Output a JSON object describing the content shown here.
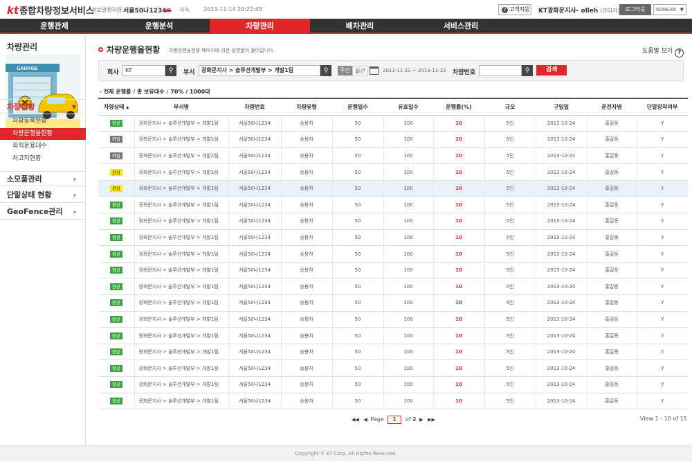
{
  "topbar": {
    "logo_kt": "kt",
    "logo_text": "종합차량정보서비스",
    "alert_label": "경보발생차량 :",
    "alert_plate": "서울50나1234",
    "alert_icon": "🚗",
    "alert_type": "과속",
    "alert_time": "2013-11-14 20:22:45",
    "support_label": "고객지원",
    "user_name": "KT광화문지사- olleh",
    "user_role": "(관리자) 님",
    "logout_label": "로그아웃",
    "lang_label": "KOREAN"
  },
  "nav": [
    "운행관제",
    "운행분석",
    "차량관리",
    "배차관리",
    "서비스관리"
  ],
  "nav_active": "차량관리",
  "sidebar": {
    "title": "차량관리",
    "banner_text": "GARAGE",
    "menus": [
      {
        "label": "차량현황",
        "arrow": "⌄"
      },
      {
        "label": "소모품관리",
        "arrow": "›"
      },
      {
        "label": "단말상태 현황",
        "arrow": "›"
      },
      {
        "label": "GeoFence관리",
        "arrow": "›"
      }
    ],
    "submenus": [
      "차량등록현황",
      "차량운행율현황",
      "최적운용대수",
      "차고지현황"
    ]
  },
  "page": {
    "title": "차량운행율현황",
    "description": "차량운행율현황 페이지에 대한 설명글이 들어갑니다.",
    "help_label": "도움말 보기",
    "help_icon": "?"
  },
  "search": {
    "company_label": "회사",
    "company_value": "KT",
    "dept_label": "부서",
    "dept_value": "광화문지사 > 솔루션개발부 > 개발1팀",
    "period_week": "주간",
    "period_month": "월간",
    "date_range": "2013-11-22 ~ 2013-11-22",
    "plate_label": "차량번호",
    "plate_value": "",
    "search_button": "검색"
  },
  "summary": "· 전체 운행률 / 총 보유대수 : 70% / 1000대",
  "table": {
    "headers": [
      "차량상태 ▴",
      "부서명",
      "차량번호",
      "차량유형",
      "운행일수",
      "유효일수",
      "운행률(%)",
      "규모",
      "구입일",
      "운전자명",
      "단말장착여부"
    ],
    "rows": [
      {
        "status": "정상",
        "dept": "광화문지사 > 솔루션개발부 > 개발1팀",
        "plate": "서울50나1234",
        "type": "승용차",
        "drive_days": "50",
        "valid_days": "100",
        "rate": "10",
        "size": "5인",
        "date": "2013-10-24",
        "driver": "홍길동",
        "device": "Y"
      },
      {
        "status": "꺼짐",
        "dept": "광화문지사 > 솔루션개발부 > 개발1팀",
        "plate": "서울50나1234",
        "type": "승용차",
        "drive_days": "50",
        "valid_days": "100",
        "rate": "10",
        "size": "5인",
        "date": "2013-10-24",
        "driver": "홍길동",
        "device": "Y"
      },
      {
        "status": "꺼짐",
        "dept": "광화문지사 > 솔루션개발부 > 개발1팀",
        "plate": "서울50나1234",
        "type": "승용차",
        "drive_days": "50",
        "valid_days": "100",
        "rate": "10",
        "size": "5인",
        "date": "2013-10-24",
        "driver": "홍길동",
        "device": "Y"
      },
      {
        "status": "관심",
        "dept": "광화문지사 > 솔루션개발부 > 개발1팀",
        "plate": "서울50나1234",
        "type": "승용차",
        "drive_days": "50",
        "valid_days": "100",
        "rate": "10",
        "size": "5인",
        "date": "2013-10-24",
        "driver": "홍길동",
        "device": "Y"
      },
      {
        "status": "관심",
        "dept": "광화문지사 > 솔루션개발부 > 개발1팀",
        "plate": "서울50나1234",
        "type": "승용차",
        "drive_days": "50",
        "valid_days": "100",
        "rate": "10",
        "size": "5인",
        "date": "2013-10-24",
        "driver": "홍길동",
        "device": "Y"
      },
      {
        "status": "정상",
        "dept": "광화문지사 > 솔루션개발부 > 개발1팀",
        "plate": "서울50나1234",
        "type": "승용차",
        "drive_days": "50",
        "valid_days": "100",
        "rate": "10",
        "size": "5인",
        "date": "2013-10-24",
        "driver": "홍길동",
        "device": "Y"
      },
      {
        "status": "정상",
        "dept": "광화문지사 > 솔루션개발부 > 개발1팀",
        "plate": "서울50나1234",
        "type": "승용차",
        "drive_days": "50",
        "valid_days": "100",
        "rate": "10",
        "size": "5인",
        "date": "2013-10-24",
        "driver": "홍길동",
        "device": "Y"
      },
      {
        "status": "정상",
        "dept": "광화문지사 > 솔루션개발부 > 개발1팀",
        "plate": "서울50나1234",
        "type": "승용차",
        "drive_days": "50",
        "valid_days": "100",
        "rate": "10",
        "size": "5인",
        "date": "2013-10-24",
        "driver": "홍길동",
        "device": "Y"
      },
      {
        "status": "정상",
        "dept": "광화문지사 > 솔루션개발부 > 개발1팀",
        "plate": "서울50나1234",
        "type": "승용차",
        "drive_days": "50",
        "valid_days": "100",
        "rate": "10",
        "size": "5인",
        "date": "2013-10-24",
        "driver": "홍길동",
        "device": "Y"
      },
      {
        "status": "정상",
        "dept": "광화문지사 > 솔루션개발부 > 개발1팀",
        "plate": "서울50나1234",
        "type": "승용차",
        "drive_days": "50",
        "valid_days": "100",
        "rate": "10",
        "size": "5인",
        "date": "2013-10-24",
        "driver": "홍길동",
        "device": "Y"
      },
      {
        "status": "정상",
        "dept": "광화문지사 > 솔루션개발부 > 개발1팀",
        "plate": "서울50나1234",
        "type": "승용차",
        "drive_days": "50",
        "valid_days": "100",
        "rate": "10",
        "size": "5인",
        "date": "2013-10-24",
        "driver": "홍길동",
        "device": "Y"
      },
      {
        "status": "정상",
        "dept": "광화문지사 > 솔루션개발부 > 개발1팀",
        "plate": "서울50나1234",
        "type": "승용차",
        "drive_days": "50",
        "valid_days": "100",
        "rate": "10",
        "size": "5인",
        "date": "2013-10-24",
        "driver": "홍길동",
        "device": "Y"
      },
      {
        "status": "정상",
        "dept": "광화문지사 > 솔루션개발부 > 개발1팀",
        "plate": "서울50나1234",
        "type": "승용차",
        "drive_days": "50",
        "valid_days": "100",
        "rate": "10",
        "size": "5인",
        "date": "2013-10-24",
        "driver": "홍길동",
        "device": "Y"
      },
      {
        "status": "정상",
        "dept": "광화문지사 > 솔루션개발부 > 개발1팀",
        "plate": "서울50나1234",
        "type": "승용차",
        "drive_days": "50",
        "valid_days": "100",
        "rate": "10",
        "size": "5인",
        "date": "2013-10-24",
        "driver": "홍길동",
        "device": "Y"
      },
      {
        "status": "정상",
        "dept": "광화문지사 > 솔루션개발부 > 개발1팀",
        "plate": "서울50나1234",
        "type": "승용차",
        "drive_days": "50",
        "valid_days": "100",
        "rate": "10",
        "size": "5인",
        "date": "2013-10-24",
        "driver": "홍길동",
        "device": "Y"
      },
      {
        "status": "정상",
        "dept": "광화문지사 > 솔루션개발부 > 개발1팀",
        "plate": "서울50나1234",
        "type": "승용차",
        "drive_days": "50",
        "valid_days": "100",
        "rate": "10",
        "size": "5인",
        "date": "2013-10-24",
        "driver": "홍길동",
        "device": "Y"
      },
      {
        "status": "정상",
        "dept": "광화문지사 > 솔루션개발부 > 개발1팀",
        "plate": "서울50나1234",
        "type": "승용차",
        "drive_days": "50",
        "valid_days": "100",
        "rate": "10",
        "size": "5인",
        "date": "2013-10-24",
        "driver": "홍길동",
        "device": "Y"
      },
      {
        "status": "정상",
        "dept": "광화문지사 > 솔루션개발부 > 개발1팀",
        "plate": "서울50나1234",
        "type": "승용차",
        "drive_days": "50",
        "valid_days": "100",
        "rate": "10",
        "size": "5인",
        "date": "2013-10-24",
        "driver": "홍길동",
        "device": "Y"
      }
    ],
    "highlighted_row": 5
  },
  "pagination": {
    "first": "◀◀",
    "prev": "◀",
    "page_label": "Page",
    "current": "1",
    "of_label": "of",
    "total": "2",
    "next": "▶",
    "last": "▶▶"
  },
  "view_info": "View 1 - 10 of 15",
  "footer": "Copyright © KT Corp. All Rights Reserved.",
  "colors": {
    "accent": "#e3262c",
    "nav_bg": "#333333",
    "normal": "#3aa53a",
    "off": "#777777",
    "care": "#ffe600"
  }
}
